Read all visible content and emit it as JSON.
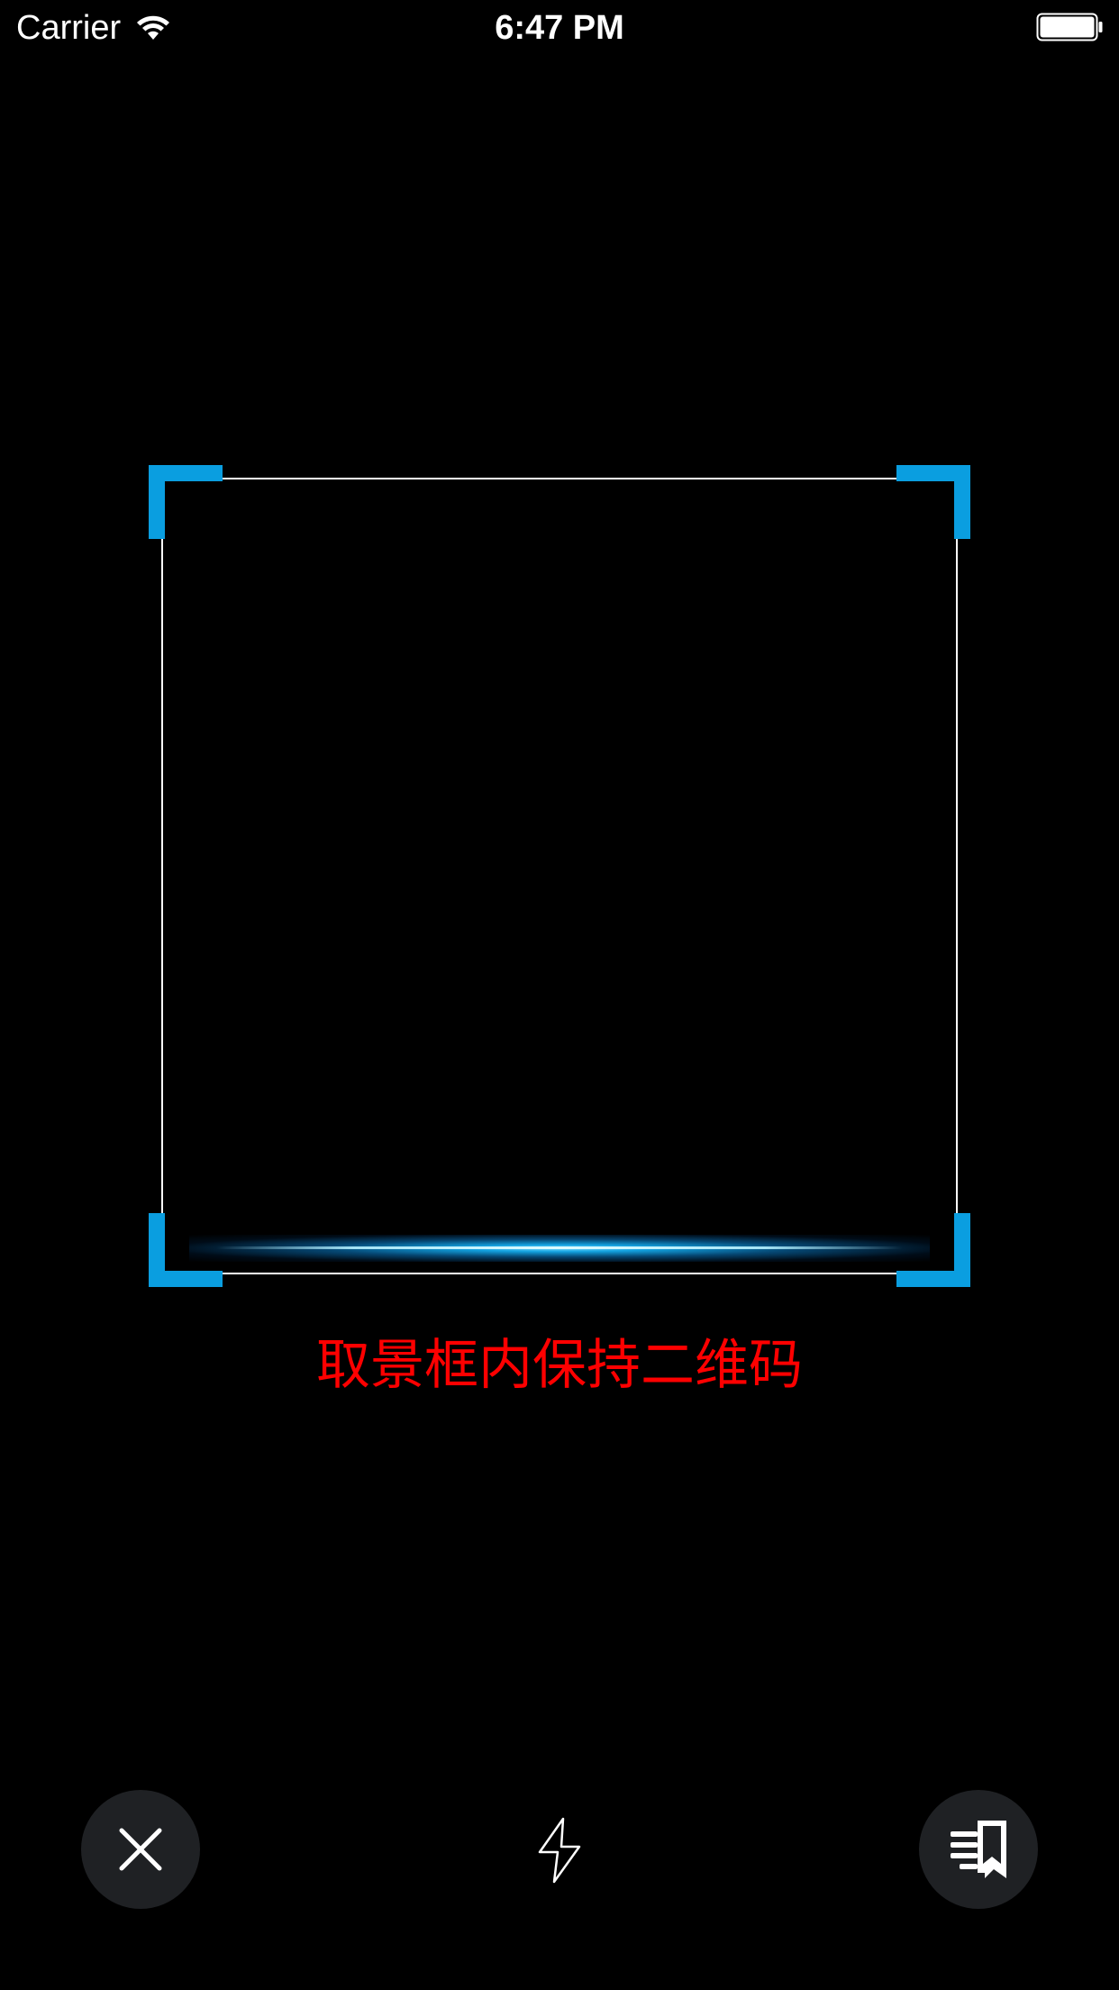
{
  "status_bar": {
    "carrier": "Carrier",
    "time": "6:47 PM",
    "wifi_icon": "wifi-icon",
    "battery_icon": "battery-full-icon"
  },
  "scanner": {
    "hint": "取景框内保持二维码",
    "hint_color": "#ff0000",
    "corner_color": "#0a9ee0",
    "frame_color": "#ffffff"
  },
  "controls": {
    "close_icon": "close-icon",
    "flash_icon": "flash-icon",
    "album_icon": "photo-album-icon",
    "button_background": "#1f2124"
  }
}
